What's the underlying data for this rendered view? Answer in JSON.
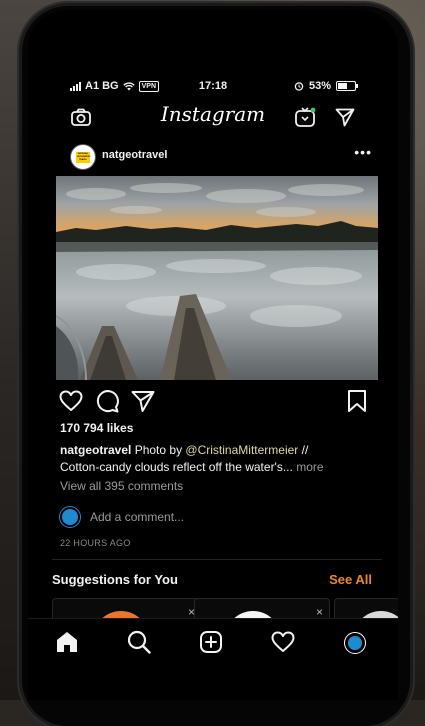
{
  "status_bar": {
    "carrier": "A1 BG",
    "vpn": "VPN",
    "time": "17:18",
    "battery": "53%"
  },
  "header": {
    "logo": "Instagram"
  },
  "post": {
    "username": "natgeotravel",
    "avatar_text": "NATIONAL GEOGRAPHIC TRAVEL",
    "more_label": "•••",
    "likes": "170 794 likes",
    "caption_user": "natgeotravel",
    "caption_prefix": "Photo by",
    "caption_mention": "@CristinaMittermeier",
    "caption_suffix": "//",
    "caption_line2": "Cotton-candy clouds reflect off the water's...",
    "caption_more": "more",
    "view_all_comments": "View all 395 comments",
    "add_comment_placeholder": "Add a comment...",
    "time_ago": "22 HOURS AGO"
  },
  "suggestions": {
    "title": "Suggestions for You",
    "see_all": "See All",
    "dismiss": "×"
  },
  "colors": {
    "accent_orange": "#e68a2e",
    "avatar_blue": "#1e8bd1",
    "background": "#000000"
  },
  "icons": {
    "camera": "camera-icon",
    "igtv": "igtv-icon",
    "direct": "direct-message-icon",
    "like": "heart-icon",
    "comment": "comment-icon",
    "share": "share-icon",
    "save": "bookmark-icon",
    "home": "home-icon",
    "search": "search-icon",
    "new_post": "plus-square-icon",
    "activity": "heart-icon",
    "profile": "profile-icon"
  }
}
